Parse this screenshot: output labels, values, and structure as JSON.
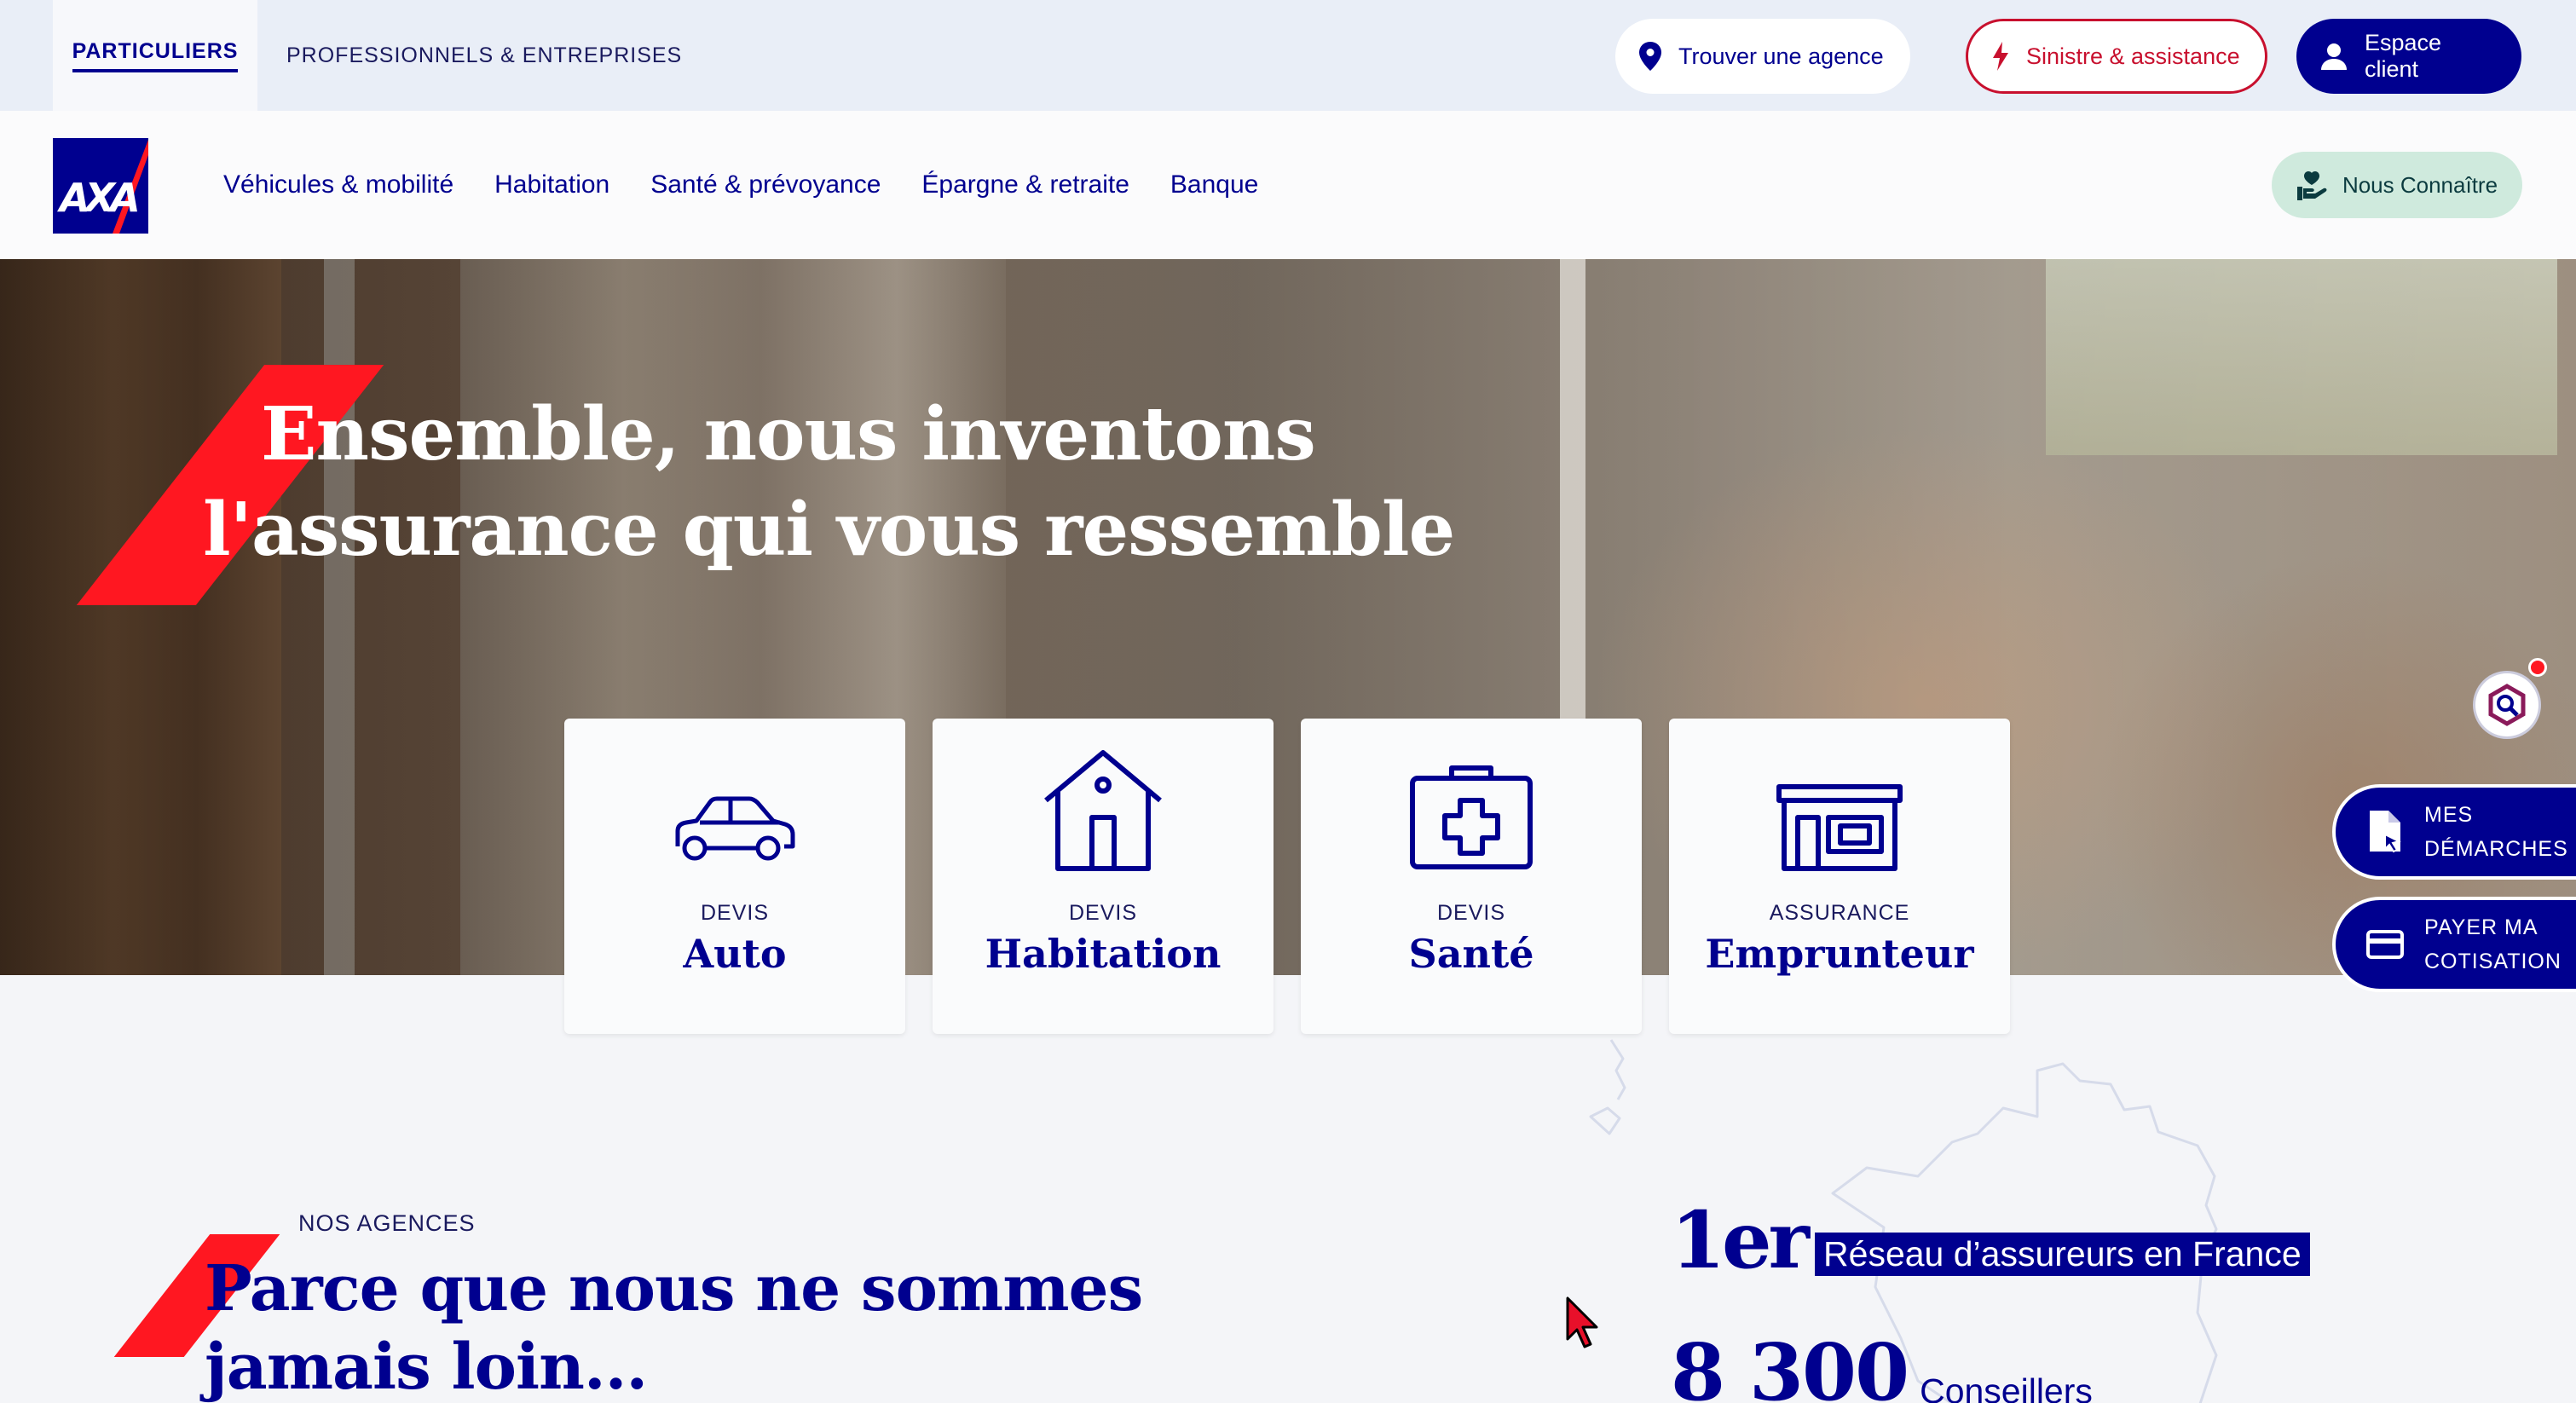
{
  "topbar": {
    "segments": [
      "PARTICULIERS",
      "PROFESSIONNELS & ENTREPRISES"
    ],
    "find_agency": "Trouver une agence",
    "claims": "Sinistre & assistance",
    "client_space": "Espace client"
  },
  "nav": {
    "links": [
      "Véhicules & mobilité",
      "Habitation",
      "Santé & prévoyance",
      "Épargne & retraite",
      "Banque"
    ],
    "about": "Nous Connaître"
  },
  "hero": {
    "title_line1": "Ensemble, nous inventons",
    "title_line2": "l'assurance qui vous ressemble"
  },
  "cards": [
    {
      "kicker": "DEVIS",
      "name": "Auto",
      "icon": "car-icon"
    },
    {
      "kicker": "DEVIS",
      "name": "Habitation",
      "icon": "house-icon"
    },
    {
      "kicker": "DEVIS",
      "name": "Santé",
      "icon": "medical-kit-icon"
    },
    {
      "kicker": "ASSURANCE",
      "name": "Emprunteur",
      "icon": "storefront-icon"
    }
  ],
  "side_buttons": {
    "procedures": [
      "MES",
      "DÉMARCHES"
    ],
    "pay": [
      "PAYER MA",
      "COTISATION"
    ]
  },
  "agencies": {
    "kicker": "NOS AGENCES",
    "title_line1": "Parce que nous ne sommes",
    "title_line2": "jamais loin...",
    "stat1_value": "1er",
    "stat1_label": "Réseau d’assureurs en France",
    "stat2_value": "8 300",
    "stat2_label": "Conseillers"
  },
  "colors": {
    "brand_blue": "#00008f",
    "brand_red": "#ff1721",
    "claims_red": "#c8102e",
    "about_green": "#cfeadd"
  }
}
